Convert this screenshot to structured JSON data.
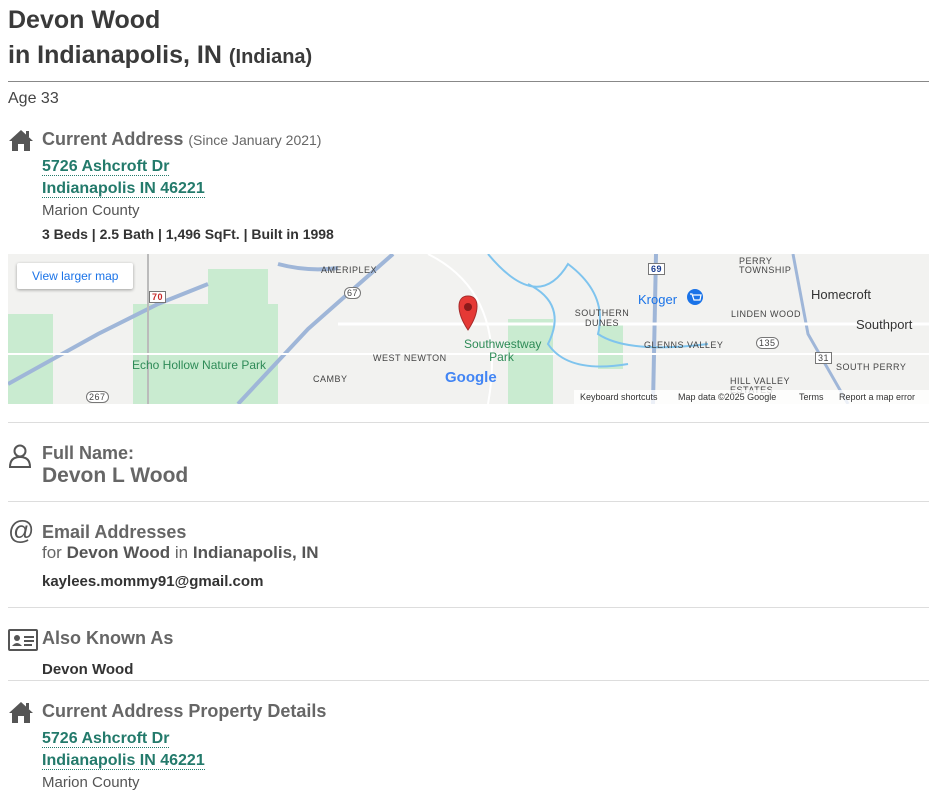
{
  "header": {
    "name": "Devon Wood",
    "location": "in Indianapolis, IN",
    "state": "(Indiana)"
  },
  "age": "Age 33",
  "current_address": {
    "title": "Current Address",
    "since": "(Since January 2021)",
    "street": "5726 Ashcroft Dr",
    "city_line": "Indianapolis IN 46221",
    "county": "Marion County",
    "facts": "3 Beds | 2.5 Bath | 1,496 SqFt. | Built in 1998"
  },
  "map": {
    "button": "View larger map",
    "labels": {
      "ameriplex": "AMERIPLEX",
      "township": "PERRY TOWNSHIP",
      "homecroft": "Homecroft",
      "southport": "Southport",
      "kroger": "Kroger",
      "southern_dunes": "SOUTHERN DUNES",
      "linden_wood": "LINDEN WOOD",
      "glenns_valley": "GLENNS VALLEY",
      "west_newton": "WEST NEWTON",
      "southwestway": "Southwestway Park",
      "echo_hollow": "Echo Hollow Nature Park",
      "camby": "CAMBY",
      "south_perry": "SOUTH PERRY",
      "hill_valley": "HILL VALLEY ESTATES",
      "google": "Google"
    },
    "shields": {
      "i70": "70",
      "s67": "67",
      "i69": "69",
      "s135": "135",
      "s31": "31",
      "s267": "267"
    },
    "footer": {
      "shortcuts": "Keyboard shortcuts",
      "data": "Map data ©2025 Google",
      "terms": "Terms",
      "report": "Report a map error"
    },
    "colors": {
      "park": "#c9ebd0",
      "water": "#7fc4ee",
      "road": "#9fb6d8",
      "pin": "#e53935"
    }
  },
  "full_name": {
    "title": "Full Name:",
    "value": "Devon L Wood"
  },
  "email": {
    "title": "Email Addresses",
    "for_prefix": "for",
    "for_name": "Devon Wood",
    "for_in": "in",
    "for_city": "Indianapolis, IN",
    "address": "kaylees.mommy91@gmail.com"
  },
  "aka": {
    "title": "Also Known As",
    "value": "Devon Wood"
  },
  "property": {
    "title": "Current Address Property Details",
    "street": "5726 Ashcroft Dr",
    "city_line": "Indianapolis IN 46221",
    "county": "Marion County"
  }
}
